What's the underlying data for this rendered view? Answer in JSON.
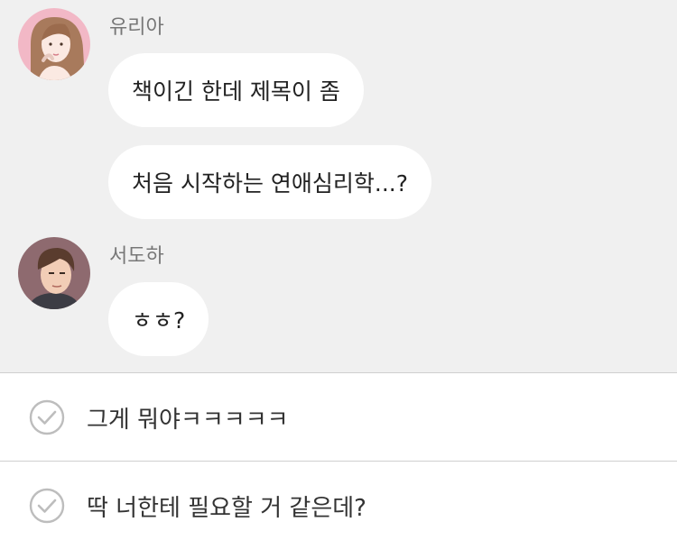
{
  "chat": {
    "messages": [
      {
        "sender": "유리아",
        "lines": [
          "책이긴 한데 제목이 좀",
          "처음 시작하는 연애심리학...?"
        ]
      },
      {
        "sender": "서도하",
        "lines": [
          "ㅎㅎ?"
        ]
      }
    ]
  },
  "choices": [
    {
      "label": "그게 뭐야ㅋㅋㅋㅋㅋ",
      "icon": "check-circle-icon"
    },
    {
      "label": "딱 너한테 필요할 거 같은데?",
      "icon": "check-circle-icon"
    }
  ],
  "colors": {
    "chat_background": "#f0f0f0",
    "bubble": "#ffffff",
    "avatar_yuria_bg": "#f2b8c6",
    "avatar_doha_bg": "#8e6a6f",
    "check_icon": "#bdbdbd"
  }
}
